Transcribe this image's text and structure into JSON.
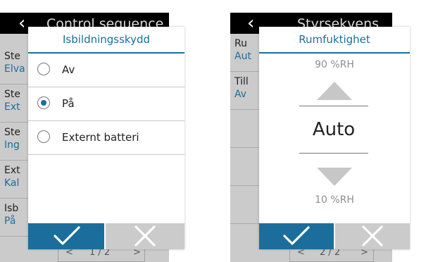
{
  "left": {
    "title": "Control sequence",
    "rows": [
      {
        "key": "Ste",
        "value": "Elva"
      },
      {
        "key": "Ste",
        "value": "Ext"
      },
      {
        "key": "Ste",
        "value": "Ing"
      },
      {
        "key": "Ext",
        "value": "Kal"
      },
      {
        "key": "Isb",
        "value": "På"
      }
    ],
    "pager": {
      "prev": "<",
      "page": "1 / 2",
      "next": ">"
    },
    "dialog": {
      "title": "Isbildningsskydd",
      "options": [
        {
          "label": "Av",
          "selected": false
        },
        {
          "label": "På",
          "selected": true
        },
        {
          "label": "Externt batteri",
          "selected": false
        }
      ]
    }
  },
  "right": {
    "title": "Styrsekvens",
    "rows": [
      {
        "key": "Ru",
        "value": "Aut"
      },
      {
        "key": "Till",
        "value": "Av"
      }
    ],
    "pager": {
      "prev": "<",
      "page": "2 / 2",
      "next": ">"
    },
    "dialog": {
      "title": "Rumfuktighet",
      "max_label": "90 %RH",
      "value": "Auto",
      "min_label": "10 %RH"
    }
  },
  "colors": {
    "accent": "#1b6e9b",
    "background": "#cbcbcb",
    "titlebar": "#000000"
  }
}
